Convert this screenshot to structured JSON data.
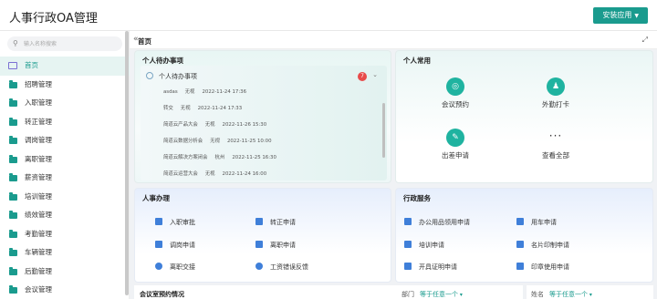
{
  "header": {
    "title": "人事行政OA管理",
    "install_label": "安装应用"
  },
  "sidebar": {
    "search_placeholder": "输入名称搜索",
    "items": [
      {
        "label": "首页",
        "active": true
      },
      {
        "label": "招聘管理"
      },
      {
        "label": "入职管理"
      },
      {
        "label": "转正管理"
      },
      {
        "label": "调岗管理"
      },
      {
        "label": "离职管理"
      },
      {
        "label": "薪资管理"
      },
      {
        "label": "培训管理"
      },
      {
        "label": "绩效管理"
      },
      {
        "label": "考勤管理"
      },
      {
        "label": "车辆管理"
      },
      {
        "label": "后勤管理"
      },
      {
        "label": "会议管理"
      }
    ]
  },
  "breadcrumb": {
    "title": "首页"
  },
  "todo": {
    "title": "个人待办事项",
    "inner_title": "个人待办事项",
    "badge": "7",
    "rows": [
      [
        "asdas",
        "无视",
        "2022-11-24 17:36"
      ],
      [
        "转交",
        "无视",
        "2022-11-24 17:33"
      ],
      [
        "简道云产品大会",
        "无视",
        "2022-11-26 15:30"
      ],
      [
        "简道云数据分析会",
        "无视",
        "2022-11-25 10:00"
      ],
      [
        "简道云解决方案闭会",
        "杭州",
        "2022-11-25 16:30"
      ],
      [
        "简道云运营大会",
        "无视",
        "2022-11-24 16:00"
      ]
    ]
  },
  "common": {
    "title": "个人常用",
    "items": [
      {
        "label": "会议预约",
        "icon": "meeting-icon"
      },
      {
        "label": "外勤打卡",
        "icon": "people-icon"
      },
      {
        "label": "出差申请",
        "icon": "doc-icon"
      },
      {
        "label": "查看全部",
        "icon": "more-icon"
      }
    ]
  },
  "hr": {
    "title": "人事办理",
    "items": [
      "入职审批",
      "转正申请",
      "调岗申请",
      "离职申请",
      "离职交接",
      "工资错误反馈"
    ]
  },
  "admin": {
    "title": "行政服务",
    "items": [
      "办公用品领用申请",
      "用车申请",
      "培训申请",
      "名片印制申请",
      "开具证明申请",
      "印章使用申请"
    ]
  },
  "bottom": {
    "section_title": "会议室预约情况",
    "filter1_label": "部门",
    "filter1_value": "等于任意一个",
    "filter2_label": "姓名",
    "filter2_value": "等于任意一个"
  },
  "colors": {
    "accent": "#1a9b8e",
    "blue": "#3f7fd9",
    "badge": "#e84a4a"
  }
}
